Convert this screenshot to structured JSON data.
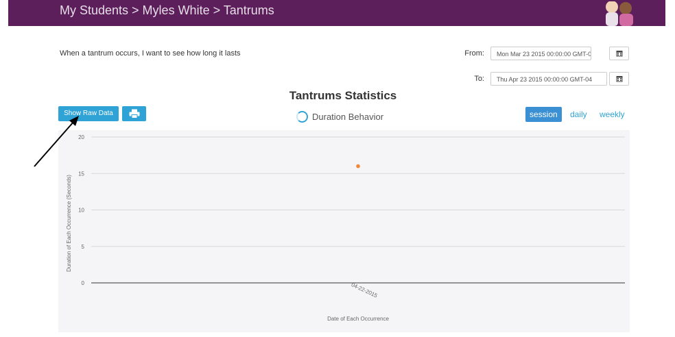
{
  "header": {
    "breadcrumb": "My Students > Myles White > Tantrums",
    "avatar_icon": "students-avatar-icon"
  },
  "intro_text": "When a tantrum occurs, I want to see how long it lasts",
  "date_range": {
    "from_label": "From:",
    "from_value": "Mon Mar 23 2015 00:00:00 GMT-0",
    "to_label": "To:",
    "to_value": "Thu Apr 23 2015 00:00:00 GMT-04",
    "calendar_icon": "calendar-icon"
  },
  "stats_title": "Tantrums Statistics",
  "toolbar": {
    "raw_data_label": "Show Raw Data",
    "print_icon": "print-icon",
    "behavior_label": "Duration Behavior",
    "views": [
      "session",
      "daily",
      "weekly"
    ],
    "active_view": "session"
  },
  "colors": {
    "header_bg": "#5c1f5c",
    "button_blue": "#2fa3d6",
    "point": "#f0883a"
  },
  "chart_data": {
    "type": "scatter",
    "title": "",
    "xlabel": "Date of Each Occurrence",
    "ylabel": "Duration of Each Occurrence (Seconds)",
    "ylim": [
      0,
      20
    ],
    "yticks": [
      "0",
      "5",
      "10",
      "15",
      "20"
    ],
    "x": [
      "04-22-2015"
    ],
    "series": [
      {
        "values": [
          16
        ]
      }
    ],
    "grid": true
  }
}
